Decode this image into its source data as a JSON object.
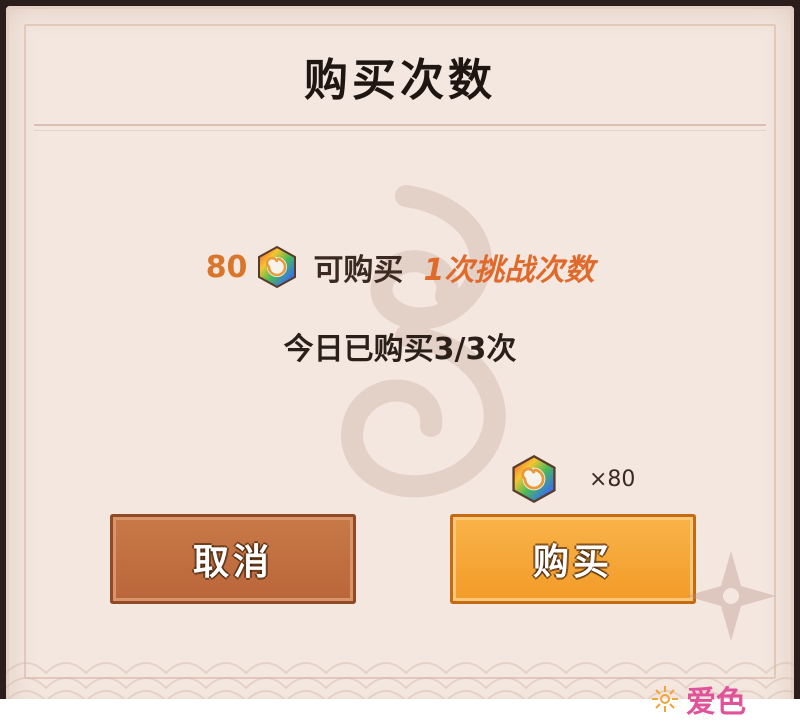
{
  "dialog": {
    "title": "购买次数",
    "price": "80",
    "purchase_label": "可购买",
    "purchase_amount": "1次挑战次数",
    "daily_status": "今日已购买3/3次",
    "cost_count": "×80"
  },
  "buttons": {
    "cancel_label": "取消",
    "buy_label": "购买"
  },
  "watermark": {
    "text": "爱色"
  },
  "colors": {
    "price": "#d9762b",
    "highlight": "#e06a2c",
    "cancel_button": "#c06f40",
    "buy_button": "#f4a333"
  },
  "icons": {
    "currency": "rainbow-gem-icon"
  }
}
